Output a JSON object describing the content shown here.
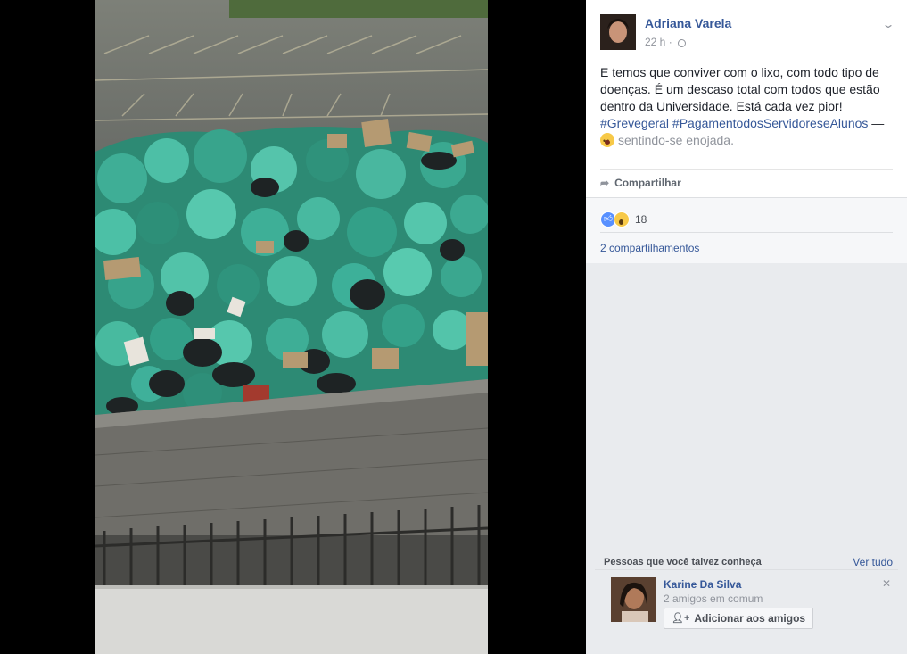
{
  "post": {
    "author": "Adriana Varela",
    "time": "22 h",
    "text_main": "E temos que conviver com o lixo, com todo tipo de doenças. É um descaso total com todos que estão dentro da Universidade. Está cada vez pior!",
    "hashtags": "#Grevegeral #PagamentodosServidoreseAlunos",
    "dash": " — ",
    "feeling": "sentindo-se enojada.",
    "share_label": "Compartilhar",
    "reaction_count": "18",
    "shares_label": "2 compartilhamentos"
  },
  "people": {
    "title": "Pessoas que você talvez conheça",
    "see_all": "Ver tudo",
    "suggestion": {
      "name": "Karine Da Silva",
      "mutual": "2 amigos em comum",
      "add_label": "Adicionar aos amigos"
    }
  },
  "icons": {
    "globe": "globe-icon",
    "chevron": "chevron-down-icon",
    "share": "share-icon",
    "like": "like-reaction-icon",
    "wow": "wow-reaction-icon",
    "close": "close-icon",
    "add_friend": "add-friend-icon"
  },
  "colors": {
    "link": "#365899",
    "bg": "#e9ebee",
    "like_blue": "#5890ff"
  }
}
